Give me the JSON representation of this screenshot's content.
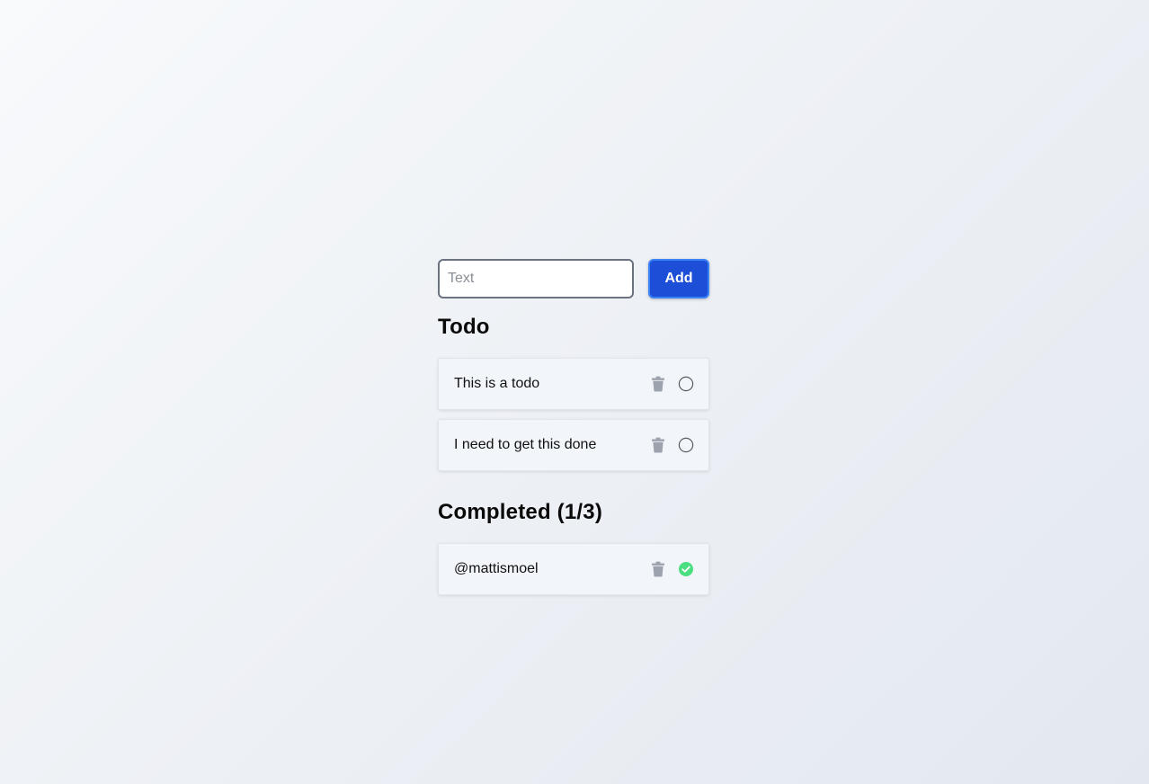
{
  "new_todo": {
    "placeholder": "Text",
    "value": "",
    "add_label": "Add"
  },
  "todo_section": {
    "title": "Todo",
    "items": [
      {
        "text": "This is a todo",
        "done": false
      },
      {
        "text": "I need to get this done",
        "done": false
      }
    ]
  },
  "completed_section": {
    "title": "Completed (1/3)",
    "items": [
      {
        "text": "@mattismoel",
        "done": true
      }
    ]
  },
  "icons": {
    "delete": "trash-icon",
    "pending": "circle-outline-icon",
    "done": "check-circle-icon"
  },
  "colors": {
    "accent": "#1d4ed8",
    "accent_border": "#3b82f6",
    "trash": "#9ca3af",
    "done": "#4ade80",
    "item_bg": "#f2f5f9"
  }
}
